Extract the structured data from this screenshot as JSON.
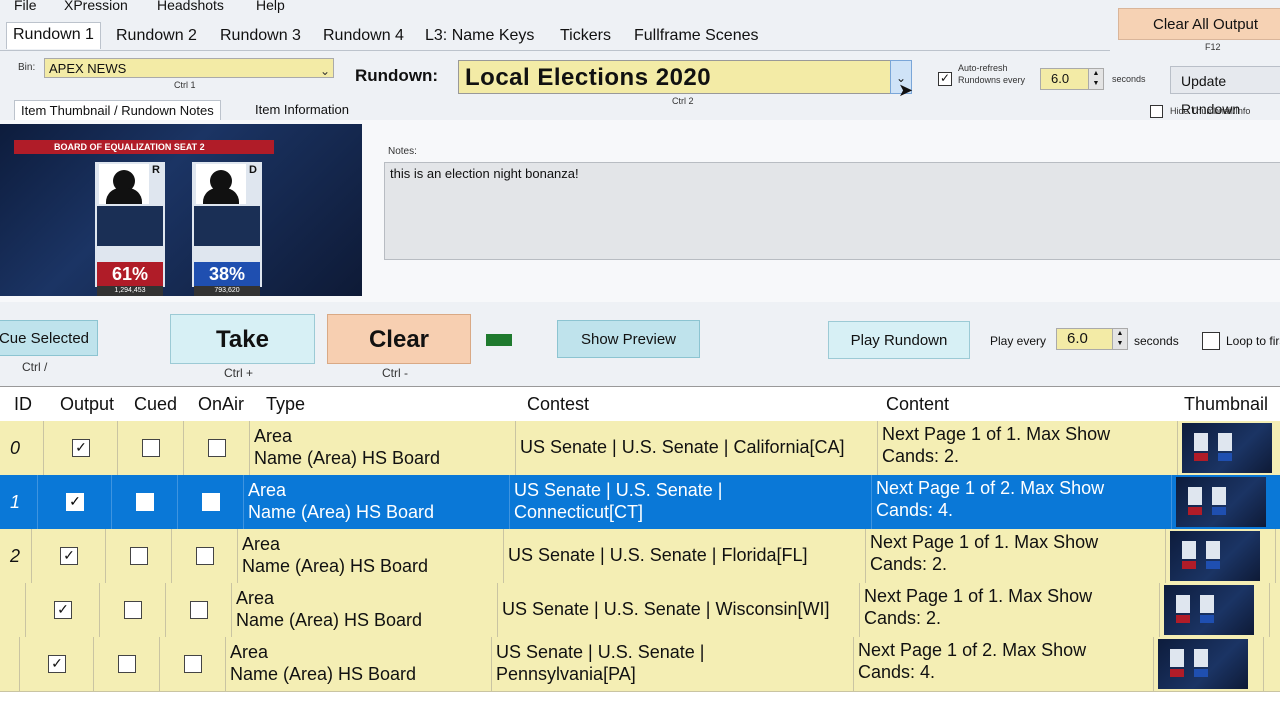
{
  "menu": [
    "File",
    "XPression",
    "Headshots",
    "Help"
  ],
  "tabs": [
    "Rundown 1",
    "Rundown 2",
    "Rundown 3",
    "Rundown 4",
    "L3: Name Keys",
    "Tickers",
    "Fullframe Scenes"
  ],
  "clear_all": {
    "label": "Clear All Output",
    "shortcut": "F12"
  },
  "bin": {
    "label": "Bin:",
    "value": "APEX NEWS",
    "shortcut": "Ctrl 1"
  },
  "rundown": {
    "label": "Rundown:",
    "value": "Local Elections 2020",
    "shortcut": "Ctrl 2"
  },
  "auto_refresh": {
    "label": "Auto-refresh Rundowns every",
    "checked": true,
    "value": "6.0",
    "unit": "seconds"
  },
  "update_button": "Update Rundown",
  "hide_thumb": {
    "label": "Hide Thumbnail/Info",
    "checked": false
  },
  "subtabs": [
    "Item Thumbnail / Rundown Notes",
    "Item Information"
  ],
  "preview": {
    "banner": "BOARD OF EQUALIZATION SEAT 2",
    "candidates": [
      {
        "party": "R",
        "pct": "61%",
        "votes": "1,294,453"
      },
      {
        "party": "D",
        "pct": "38%",
        "votes": "793,620"
      }
    ]
  },
  "notes": {
    "label": "Notes:",
    "text": "this is an election night bonanza!"
  },
  "buttons": {
    "cue": {
      "label": "Cue Selected",
      "shortcut": "Ctrl /"
    },
    "take": {
      "label": "Take",
      "shortcut": "Ctrl +"
    },
    "clear": {
      "label": "Clear",
      "shortcut": "Ctrl -"
    },
    "show_preview": "Show Preview",
    "play_rundown": "Play Rundown"
  },
  "play_every": {
    "label": "Play every",
    "value": "6.0",
    "unit": "seconds",
    "loop_label": "Loop to first"
  },
  "table": {
    "headers": [
      "ID",
      "Output",
      "Cued",
      "OnAir",
      "Type",
      "Contest",
      "Content",
      "Thumbnail"
    ],
    "rows": [
      {
        "id": "0",
        "output": true,
        "cued": false,
        "onair": false,
        "type1": "Area",
        "type2": "Name (Area) HS Board",
        "contest1": "US Senate | U.S. Senate | California[CA]",
        "contest2": "",
        "content1": "Next Page 1 of 1. Max Show",
        "content2": "Cands: 2.",
        "selected": false
      },
      {
        "id": "1",
        "output": true,
        "cued": false,
        "onair": false,
        "type1": "Area",
        "type2": "Name (Area) HS Board",
        "contest1": "US Senate | U.S. Senate |",
        "contest2": "Connecticut[CT]",
        "content1": "Next Page 1 of 2. Max Show",
        "content2": "Cands: 4.",
        "selected": true
      },
      {
        "id": "2",
        "output": true,
        "cued": false,
        "onair": false,
        "type1": "Area",
        "type2": "Name (Area) HS Board",
        "contest1": "US Senate | U.S. Senate | Florida[FL]",
        "contest2": "",
        "content1": "Next Page 1 of 1. Max Show",
        "content2": "Cands: 2.",
        "selected": false
      },
      {
        "id": "",
        "output": true,
        "cued": false,
        "onair": false,
        "type1": "Area",
        "type2": "Name (Area) HS Board",
        "contest1": "US Senate | U.S. Senate | Wisconsin[WI]",
        "contest2": "",
        "content1": "Next Page 1 of 1. Max Show",
        "content2": "Cands: 2.",
        "selected": false
      },
      {
        "id": "",
        "output": true,
        "cued": false,
        "onair": false,
        "type1": "Area",
        "type2": "Name (Area) HS Board",
        "contest1": "US Senate | U.S. Senate |",
        "contest2": "Pennsylvania[PA]",
        "content1": "Next Page 1 of 2. Max Show",
        "content2": "Cands: 4.",
        "selected": false
      }
    ]
  },
  "colors": {
    "row_bg": "#f4eeb4",
    "selected_bg": "#0a78d7",
    "take_bg": "#d7f0f5",
    "clear_bg": "#f7cfb1"
  }
}
